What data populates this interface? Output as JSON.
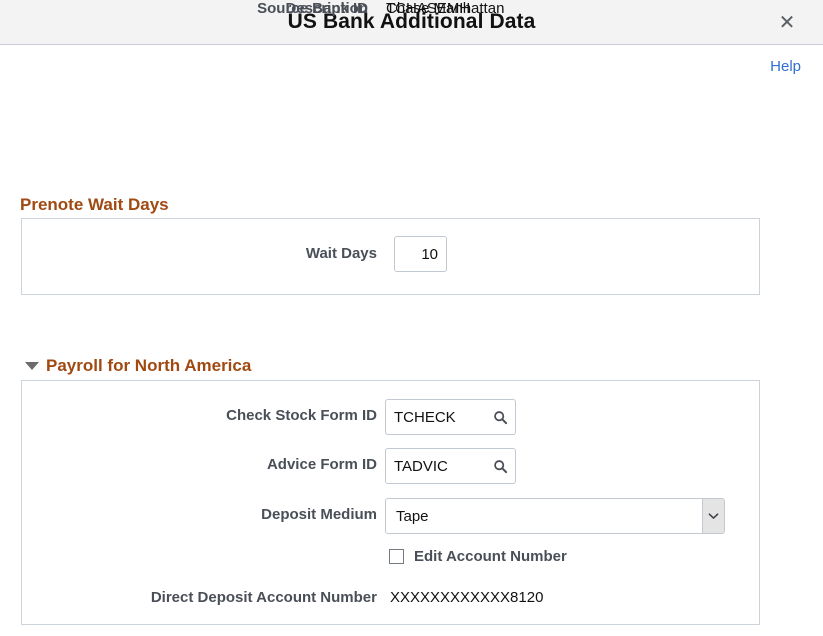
{
  "modal": {
    "title": "US Bank Additional Data",
    "close_icon": "close-icon",
    "close_glyph": "✕"
  },
  "help": {
    "label": "Help"
  },
  "summary": {
    "source_bank_id_label": "Source Bank ID",
    "source_bank_id_value": "TCHASEMH",
    "description_label": "Description",
    "description_value": "Chase Manhattan"
  },
  "prenote": {
    "section_title": "Prenote Wait Days",
    "wait_days_label": "Wait Days",
    "wait_days_value": "10",
    "wait_days_placeholder": ""
  },
  "payroll": {
    "section_title": "Payroll for North America",
    "collapse_icon": "triangle-down-icon",
    "expanded": true,
    "check_stock_form_id_label": "Check Stock Form ID",
    "check_stock_form_id_value": "TCHECK",
    "check_stock_lookup_icon": "search-icon",
    "advice_form_id_label": "Advice Form ID",
    "advice_form_id_value": "TADVIC",
    "advice_lookup_icon": "search-icon",
    "deposit_medium_label": "Deposit Medium",
    "deposit_medium_value": "Tape",
    "deposit_medium_arrow_icon": "chevron-down-icon",
    "edit_account_number_label": "Edit Account Number",
    "edit_account_number_checked": false,
    "direct_deposit_account_number_label": "Direct Deposit Account Number",
    "direct_deposit_account_number_value": "XXXXXXXXXXXX8120"
  },
  "colors": {
    "section_header": "#a04a12",
    "label": "#4a4f57",
    "link": "#2f6fd0",
    "header_bg": "#f3f3f3",
    "box_border": "#ccd3da"
  }
}
